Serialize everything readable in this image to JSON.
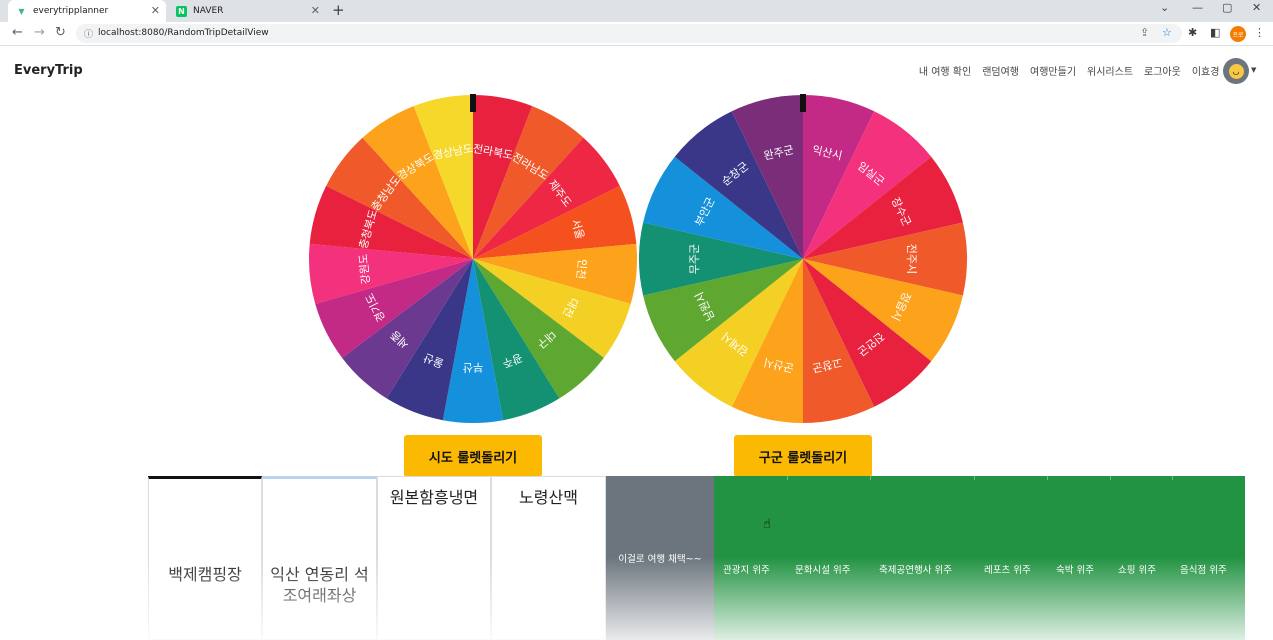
{
  "browser": {
    "tabs": [
      {
        "title": "everytripplanner",
        "active": true
      },
      {
        "title": "NAVER",
        "active": false
      }
    ],
    "url": "localhost:8080/RandomTripDetailView",
    "profile_label": "프로"
  },
  "header": {
    "brand": "EveryTrip",
    "nav": [
      "내 여행 확인",
      "랜덤여행",
      "여행만들기",
      "위시리스트",
      "로그아웃",
      "이효경 님,"
    ]
  },
  "wheels": {
    "sido": {
      "labels": [
        "전라북도",
        "전라남도",
        "제주도",
        "서울",
        "인천",
        "대전",
        "대구",
        "광주",
        "부산",
        "울산",
        "세종",
        "경기도",
        "강원도",
        "충청북도",
        "충청남도",
        "경상북도",
        "경상남도"
      ],
      "colors": [
        "#e8213f",
        "#f0592a",
        "#ee2844",
        "#f4511e",
        "#fca21b",
        "#f5d024",
        "#5ea832",
        "#139172",
        "#1591db",
        "#3a3789",
        "#6b3a90",
        "#c32a85",
        "#f4317d",
        "#e8213f",
        "#f0592a",
        "#fca21b",
        "#f5d82a"
      ],
      "button": "시도 룰렛돌리기"
    },
    "gugun": {
      "labels": [
        "익산시",
        "임실군",
        "장수군",
        "전주시",
        "정읍시",
        "진안군",
        "고창군",
        "군산시",
        "김제시",
        "남원시",
        "무주군",
        "부안군",
        "순창군",
        "완주군"
      ],
      "colors": [
        "#c32a85",
        "#f4317d",
        "#e8213f",
        "#f0592a",
        "#fca21b",
        "#e8213f",
        "#f0592a",
        "#fca21b",
        "#f5d024",
        "#5ea832",
        "#139172",
        "#1591db",
        "#3a3789",
        "#7a2e7a"
      ],
      "button": "구군 룰렛돌리기"
    }
  },
  "cards": [
    "백제캠핑장",
    "익산 연동리 석조여래좌상",
    "원본함흥냉면",
    "노령산맥"
  ],
  "decision_button": "이걸로 여행 채택~~",
  "categories": [
    "관광지 위주",
    "문화시설 위주",
    "축제공연행사 위주",
    "레포츠 위주",
    "숙박 위주",
    "쇼핑 위주",
    "음식점 위주"
  ]
}
